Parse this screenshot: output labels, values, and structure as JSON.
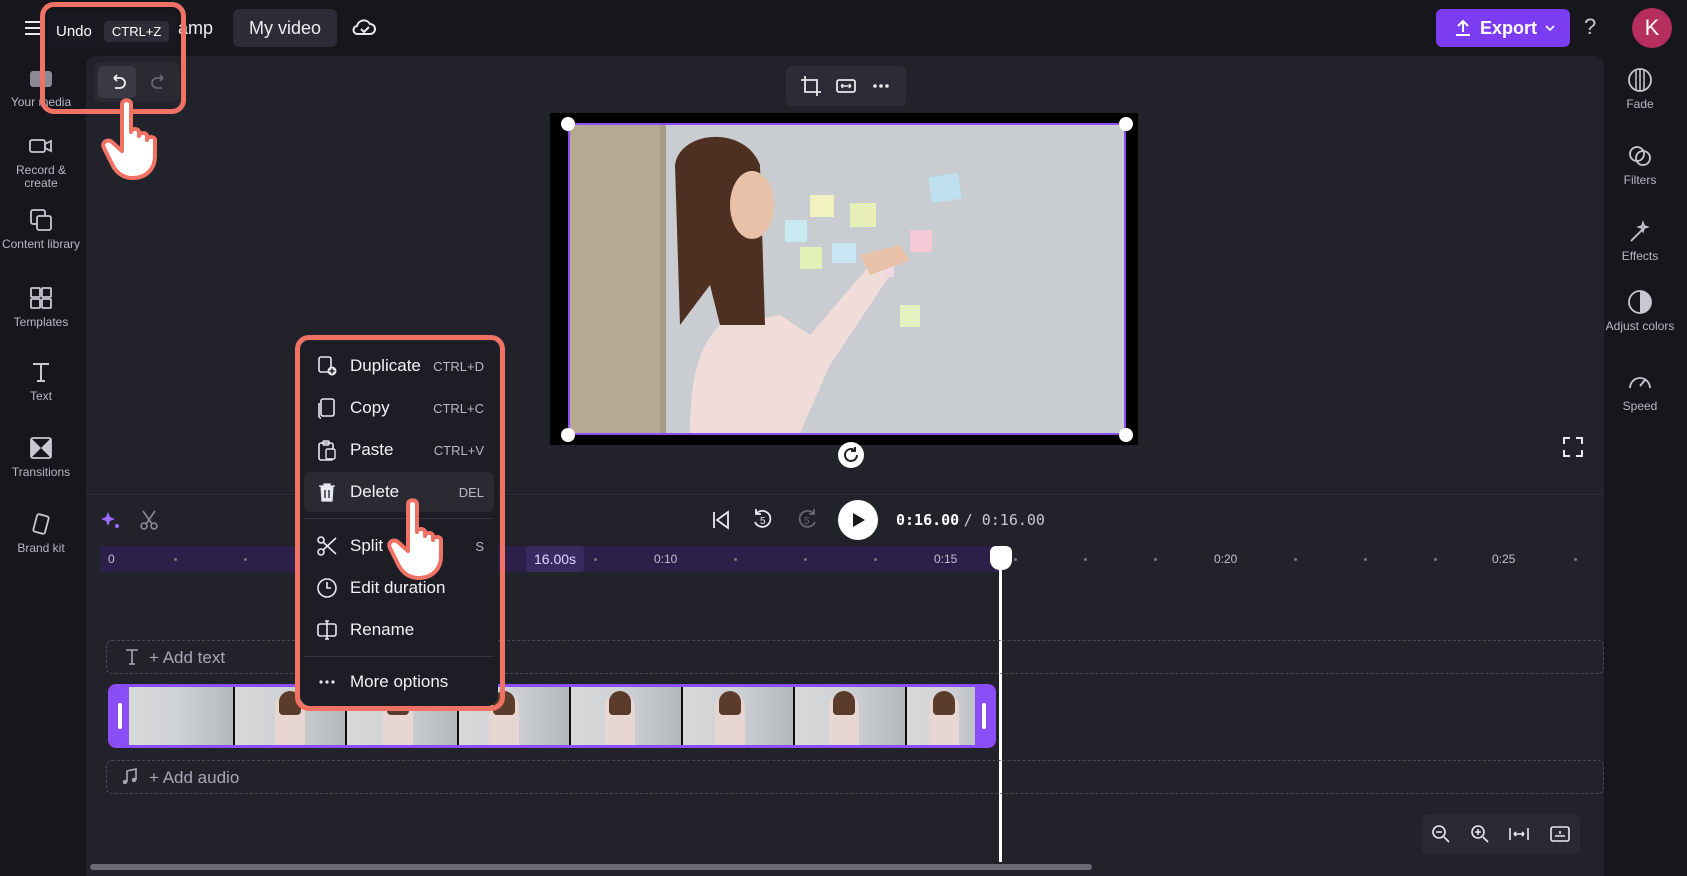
{
  "header": {
    "brand_partial": "amp",
    "project_title": "My video",
    "export_label": "Export",
    "help": "?",
    "avatar_initial": "K"
  },
  "tooltip": {
    "label": "Undo",
    "shortcut": "CTRL+Z"
  },
  "left_sidebar": [
    {
      "label": "Your media",
      "icon": "folder-icon"
    },
    {
      "label": "Record & create",
      "icon": "camera-icon"
    },
    {
      "label": "Content library",
      "icon": "library-icon"
    },
    {
      "label": "Templates",
      "icon": "templates-icon"
    },
    {
      "label": "Text",
      "icon": "text-icon"
    },
    {
      "label": "Transitions",
      "icon": "transitions-icon"
    },
    {
      "label": "Brand kit",
      "icon": "brand-kit-icon"
    }
  ],
  "right_sidebar": [
    {
      "label": "Fade",
      "icon": "fade-icon"
    },
    {
      "label": "Filters",
      "icon": "filters-icon"
    },
    {
      "label": "Effects",
      "icon": "effects-icon"
    },
    {
      "label": "Adjust colors",
      "icon": "adjust-colors-icon"
    },
    {
      "label": "Speed",
      "icon": "speed-icon"
    }
  ],
  "context_menu": [
    {
      "label": "Duplicate",
      "shortcut": "CTRL+D",
      "icon": "duplicate-icon"
    },
    {
      "label": "Copy",
      "shortcut": "CTRL+C",
      "icon": "copy-icon"
    },
    {
      "label": "Paste",
      "shortcut": "CTRL+V",
      "icon": "paste-icon"
    },
    {
      "label": "Delete",
      "shortcut": "DEL",
      "icon": "trash-icon"
    },
    {
      "label": "Split",
      "shortcut": "S",
      "icon": "scissors-icon"
    },
    {
      "label": "Edit duration",
      "shortcut": "",
      "icon": "clock-icon"
    },
    {
      "label": "Rename",
      "shortcut": "",
      "icon": "rename-icon"
    },
    {
      "label": "More options",
      "shortcut": "",
      "icon": "more-icon"
    }
  ],
  "playback": {
    "current_time": "0:16.00",
    "total_time": "/ 0:16.00",
    "skip_back_seconds": "5",
    "skip_forward_seconds": "5"
  },
  "ruler": {
    "labels": [
      "0",
      "0:10",
      "0:15",
      "0:20",
      "0:25"
    ],
    "clip_duration": "16.00s"
  },
  "tracks": {
    "add_text": "+ Add text",
    "add_audio": "+ Add audio"
  },
  "colors": {
    "accent": "#7c3cf2",
    "highlight": "#f07264",
    "avatar": "#b52e5c"
  }
}
